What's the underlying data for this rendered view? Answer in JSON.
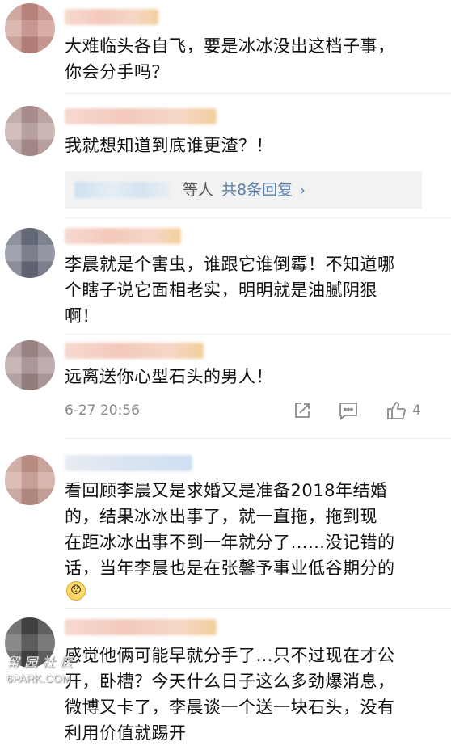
{
  "comments": [
    {
      "text": "大难临头各自飞，要是冰冰没出这档子事，\n你会分手吗？"
    },
    {
      "text": "我就想知道到底谁更渣？！",
      "reply_summary": {
        "suffix": "等人",
        "count_label": "共8条回复",
        "arrow": "›"
      }
    },
    {
      "text": "李晨就是个害虫，谁跟它谁倒霉！不知道哪\n个瞎子说它面相老实，明明就是油腻阴狠\n啊！"
    },
    {
      "text": "远离送你心型石头的男人！",
      "meta": {
        "time": "6-27 20:56",
        "like_count": "4"
      }
    },
    {
      "text": "看回顾李晨又是求婚又是准备2018年结婚\n的，结果冰冰出事了，就一直拖，拖到现\n在距冰冰出事不到一年就分了……没记错的\n话，当年李晨也是在张馨予事业低谷期分的",
      "emoji": "😯"
    },
    {
      "text": "感觉他俩可能早就分手了…只不过现在才公\n开，卧槽？今天什么日子这么多劲爆消息，\n微博又卡了，李晨谈一个送一块石头，没有\n利用价值就踢开"
    }
  ],
  "watermark": {
    "cn": "留园社区",
    "en": "6PARK.COM"
  },
  "colors": {
    "link": "#5b7fa8",
    "meta": "#8a8a8a",
    "reply_bg": "#f2f2f2"
  }
}
